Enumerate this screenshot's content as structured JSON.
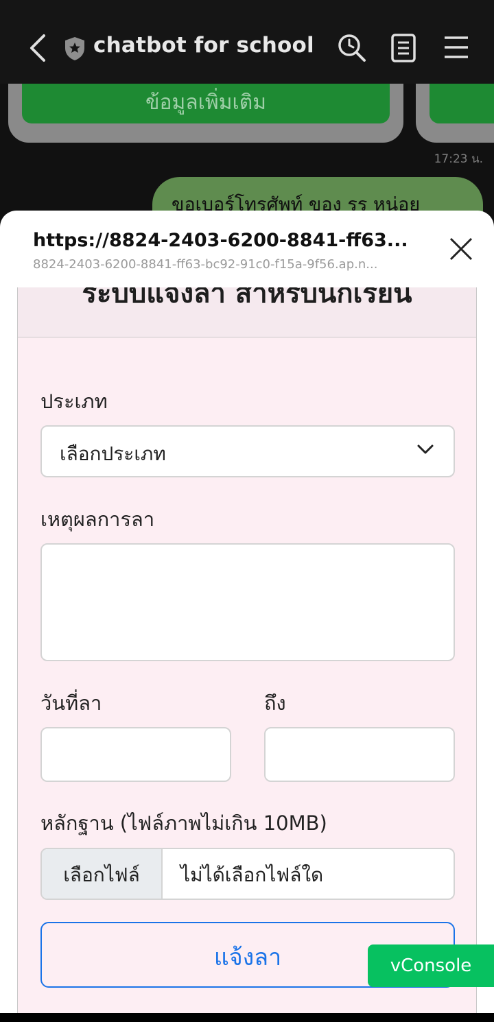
{
  "app_bar": {
    "title": "chatbot for school",
    "icons": [
      "back-arrow-icon",
      "shield-star-icon",
      "search-icon",
      "note-icon",
      "menu-icon"
    ]
  },
  "chat": {
    "card_button_label": "ข้อมูลเพิ่มเติม",
    "timestamp": "17:23 น.",
    "message": "ขอเบอร์โทรศัพท์ ของ รร หน่อย"
  },
  "sheet": {
    "url": "https://8824-2403-6200-8841-ff63...",
    "subtitle": "8824-2403-6200-8841-ff63-bc92-91c0-f15a-9f56.ap.n..."
  },
  "form": {
    "title": "ระบบแจ้งลา สำหรับนักเรียน",
    "type_label": "ประเภท",
    "type_selected": "เลือกประเภท",
    "reason_label": "เหตุผลการลา",
    "reason_value": "",
    "date_from_label": "วันที่ลา",
    "date_to_label": "ถึง",
    "evidence_label": "หลักฐาน (ไฟล์ภาพไม่เกิน 10MB)",
    "file_button": "เลือกไฟล์",
    "file_status": "ไม่ได้เลือกไฟล์ใด",
    "submit_label": "แจ้งลา"
  },
  "vconsole_label": "vConsole",
  "colors": {
    "accent_blue": "#1a73e8",
    "vconsole_green": "#07c160",
    "form_bg": "#fdeef3",
    "chat_bubble": "#5f8c4f",
    "card_button_green": "#1e8a33"
  }
}
